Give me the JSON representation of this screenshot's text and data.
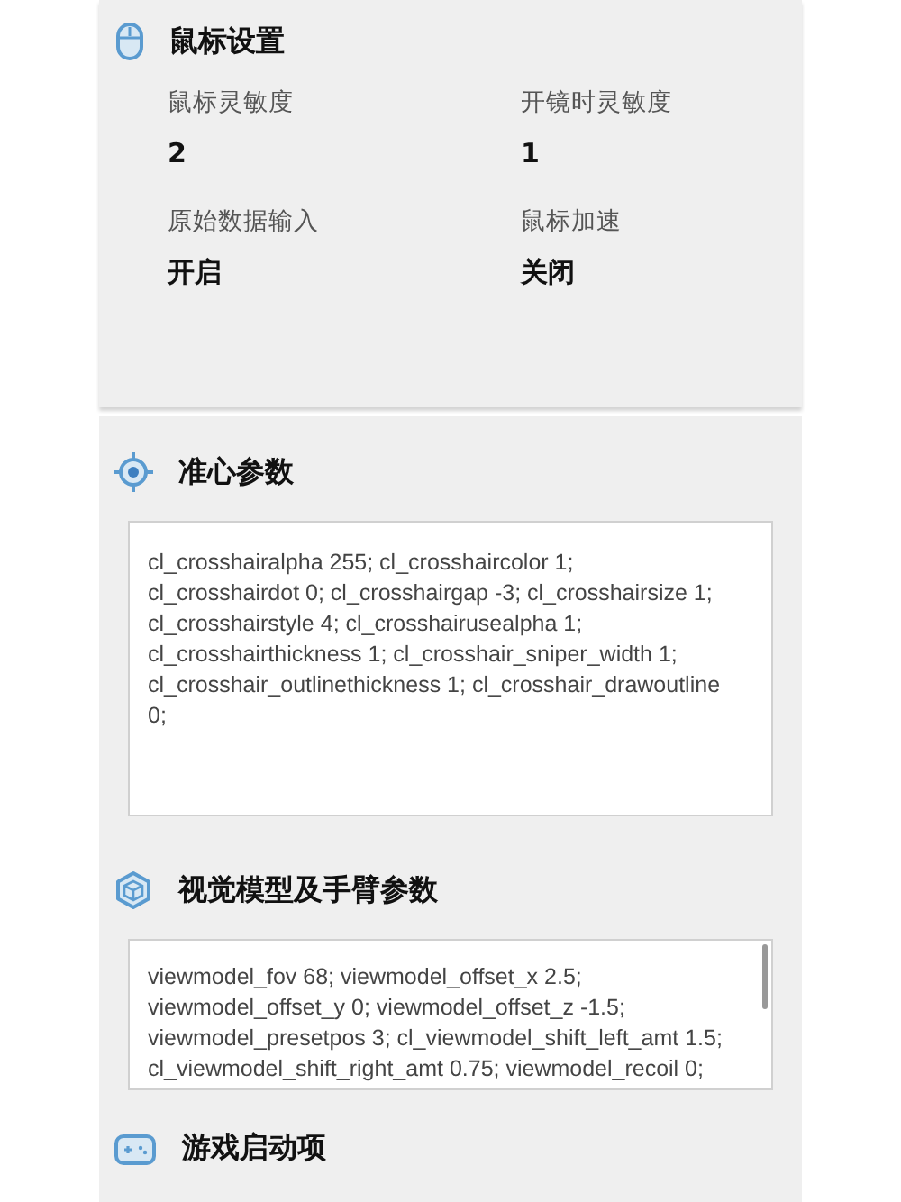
{
  "mouse_settings": {
    "title": "鼠标设置",
    "fields": [
      {
        "label": "鼠标灵敏度",
        "value": "2"
      },
      {
        "label": "开镜时灵敏度",
        "value": "1"
      },
      {
        "label": "原始数据输入",
        "value": "开启"
      },
      {
        "label": "鼠标加速",
        "value": "关闭"
      }
    ]
  },
  "crosshair": {
    "title": "准心参数",
    "value": "cl_crosshairalpha 255; cl_crosshaircolor 1;\ncl_crosshairdot 0; cl_crosshairgap -3; cl_crosshairsize 1;\ncl_crosshairstyle 4; cl_crosshairusealpha 1;\ncl_crosshairthickness 1; cl_crosshair_sniper_width 1;\ncl_crosshair_outlinethickness 1; cl_crosshair_drawoutline\n0;"
  },
  "viewmodel": {
    "title": "视觉模型及手臂参数",
    "value": "viewmodel_fov 68; viewmodel_offset_x 2.5;\nviewmodel_offset_y 0; viewmodel_offset_z -1.5;\nviewmodel_presetpos 3; cl_viewmodel_shift_left_amt 1.5;\ncl_viewmodel_shift_right_amt 0.75; viewmodel_recoil 0;"
  },
  "launch_options": {
    "title": "游戏启动项"
  }
}
